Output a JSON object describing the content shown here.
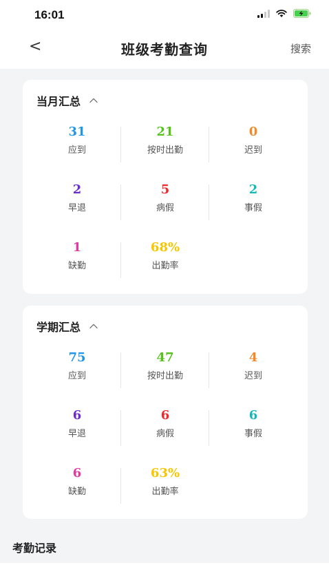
{
  "status_bar": {
    "time": "16:01"
  },
  "nav": {
    "back_glyph": "<",
    "title": "班级考勤查询",
    "search_label": "搜索"
  },
  "colors": {
    "blue": "#2196e8",
    "green": "#56c21b",
    "orange": "#f08b2c",
    "purple": "#6a2bd0",
    "red": "#ef2a2a",
    "teal": "#14b8b8",
    "pink": "#e23aa0",
    "yellow": "#f7c600"
  },
  "monthly": {
    "title": "当月汇总",
    "stats": [
      {
        "value": "31",
        "label": "应到",
        "color": "#2196e8"
      },
      {
        "value": "21",
        "label": "按时出勤",
        "color": "#56c21b"
      },
      {
        "value": "0",
        "label": "迟到",
        "color": "#f08b2c"
      },
      {
        "value": "2",
        "label": "早退",
        "color": "#6a2bd0"
      },
      {
        "value": "5",
        "label": "病假",
        "color": "#ef2a2a"
      },
      {
        "value": "2",
        "label": "事假",
        "color": "#14b8b8"
      },
      {
        "value": "1",
        "label": "缺勤",
        "color": "#e23aa0"
      },
      {
        "value": "68%",
        "label": "出勤率",
        "color": "#f7c600"
      }
    ]
  },
  "semester": {
    "title": "学期汇总",
    "stats": [
      {
        "value": "75",
        "label": "应到",
        "color": "#2196e8"
      },
      {
        "value": "47",
        "label": "按时出勤",
        "color": "#56c21b"
      },
      {
        "value": "4",
        "label": "迟到",
        "color": "#f08b2c"
      },
      {
        "value": "6",
        "label": "早退",
        "color": "#6a2bd0"
      },
      {
        "value": "6",
        "label": "病假",
        "color": "#ef2a2a"
      },
      {
        "value": "6",
        "label": "事假",
        "color": "#14b8b8"
      },
      {
        "value": "6",
        "label": "缺勤",
        "color": "#e23aa0"
      },
      {
        "value": "63%",
        "label": "出勤率",
        "color": "#f7c600"
      }
    ]
  },
  "records": {
    "title": "考勤记录"
  }
}
